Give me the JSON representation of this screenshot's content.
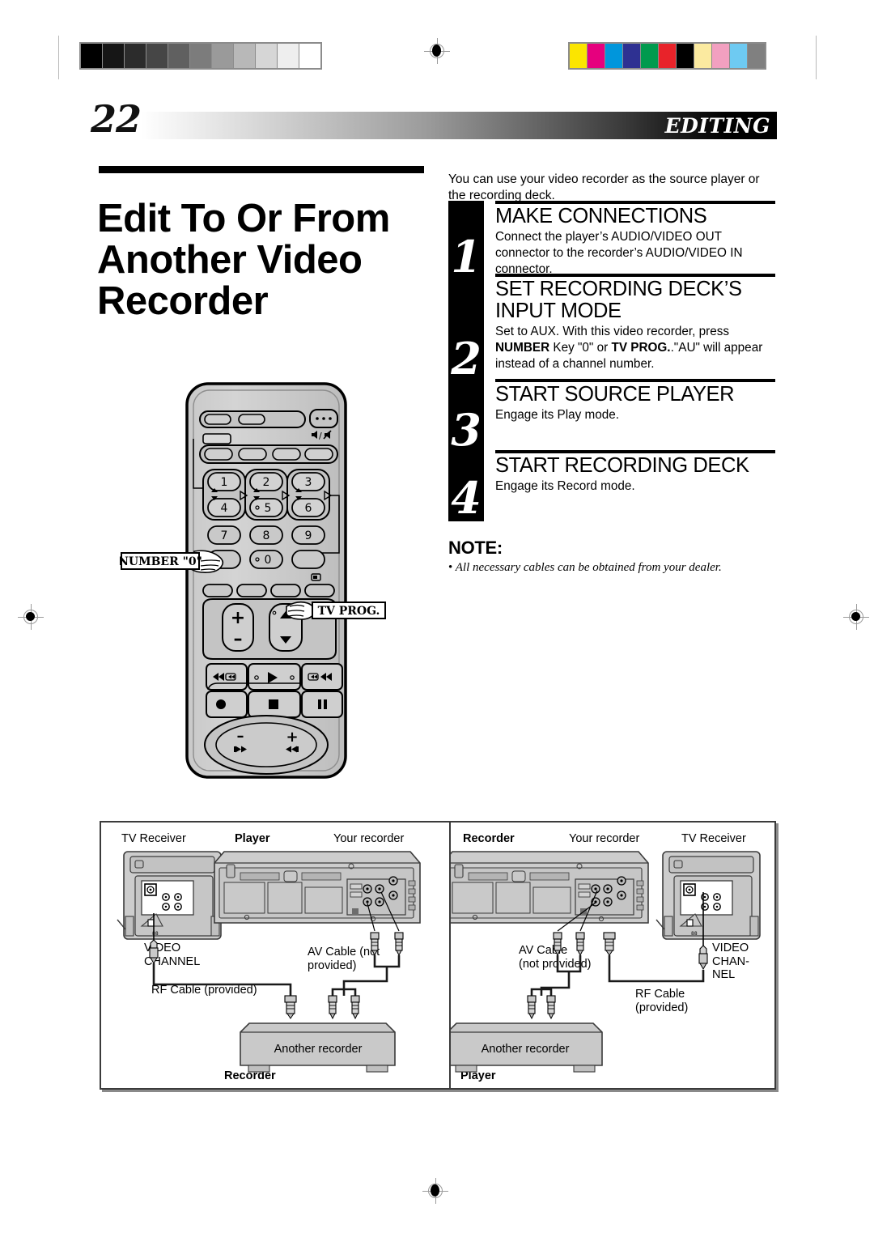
{
  "header": {
    "page_number": "22",
    "section": "EDITING"
  },
  "title": "Edit To Or From Another Video Recorder",
  "intro": "You can use your video recorder as the source player or the recording deck.",
  "steps": [
    {
      "number": "1",
      "heading": "MAKE CONNECTIONS",
      "text": "Connect the player’s AUDIO/VIDEO OUT connector to the recorder’s AUDIO/VIDEO IN connector."
    },
    {
      "number": "2",
      "heading": "SET RECORDING DECK’S INPUT MODE",
      "text_1": "Set to AUX. With this video recorder, press ",
      "text_b1": "NUMBER",
      "text_2": " Key \"0\" or ",
      "text_b2": "TV PROG.",
      "text_3": ".\"AU\" will appear instead of a channel number."
    },
    {
      "number": "3",
      "heading": "START SOURCE PLAYER",
      "text": "Engage its Play mode."
    },
    {
      "number": "4",
      "heading": "START RECORDING DECK",
      "text": "Engage its Record mode."
    }
  ],
  "note": {
    "heading": "NOTE:",
    "bullet": "•",
    "item": "All necessary cables can be obtained from your dealer."
  },
  "remote": {
    "callout_number_zero": "NUMBER \"0\"",
    "callout_tv_prog": "TV PROG.",
    "keys": [
      "1",
      "2",
      "3",
      "4",
      "5",
      "6",
      "7",
      "8",
      "9",
      "0"
    ],
    "volume_plus": "+",
    "volume_minus": "–",
    "shuttle_minus": "–",
    "shuttle_plus": "+"
  },
  "diagram": {
    "left": {
      "tv_receiver": "TV Receiver",
      "player": "Player",
      "your_recorder": "Your recorder",
      "video_channel": "VIDEO\nCHANNEL",
      "av_cable": "AV Cable (not\nprovided)",
      "rf_cable": "RF Cable (provided)",
      "another_recorder": "Another recorder",
      "recorder_caption": "Recorder"
    },
    "right": {
      "recorder": "Recorder",
      "your_recorder": "Your recorder",
      "tv_receiver": "TV Receiver",
      "av_cable": "AV Cable\n(not provided)",
      "rf_cable": "RF Cable\n(provided)",
      "video_channel": "VIDEO\nCHAN-\nNEL",
      "another_recorder": "Another recorder",
      "player_caption": "Player"
    }
  },
  "print_marks": {
    "grayscale_swatches": [
      "#000000",
      "#161616",
      "#2c2c2c",
      "#464646",
      "#606060",
      "#7c7c7c",
      "#9a9a9a",
      "#b8b8b8",
      "#d6d6d6",
      "#eeeeee",
      "#ffffff"
    ],
    "color_swatches": [
      "#fbe500",
      "#e6007e",
      "#0096dc",
      "#2e3192",
      "#009a4e",
      "#e8232a",
      "#000000",
      "#fbeaa0",
      "#f2a0c0",
      "#6ecaf2",
      "#808080"
    ]
  }
}
